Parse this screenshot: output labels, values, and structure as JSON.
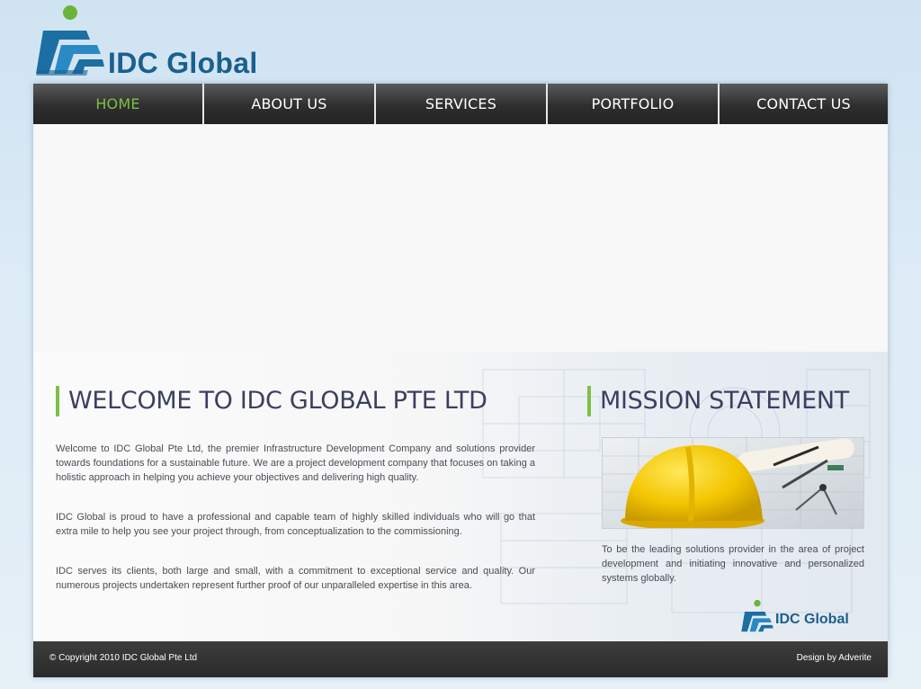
{
  "brand": {
    "name": "IDC Global",
    "primary_color": "#1b5f8f",
    "accent_color": "#7dc142",
    "logo_icon": "idc-logo-icon"
  },
  "nav": {
    "items": [
      {
        "label": "HOME",
        "active": true
      },
      {
        "label": "ABOUT US",
        "active": false
      },
      {
        "label": "SERVICES",
        "active": false
      },
      {
        "label": "PORTFOLIO",
        "active": false
      },
      {
        "label": "CONTACT US",
        "active": false
      }
    ]
  },
  "welcome": {
    "heading": "WELCOME TO IDC GLOBAL PTE LTD",
    "paragraphs": [
      "Welcome to IDC Global Pte Ltd, the premier Infrastructure Development Company and solutions provider towards foundations for a sustainable future. We are a project development company that focuses on taking a holistic approach in helping you achieve your objectives and delivering high quality.",
      "IDC Global is proud to have a professional and capable team of highly skilled individuals who will go  that extra mile to help you see your project through, from conceptualization to the commissioning.",
      "IDC serves its clients, both large and small, with a commitment to exceptional service and quality. Our numerous projects undertaken represent further proof of our unparalleled expertise in this area."
    ]
  },
  "mission": {
    "heading": "MISSION STATEMENT",
    "image_icon": "hard-hat-image",
    "text": "To be the leading solutions provider in the area of project development and initiating innovative and personalized systems globally."
  },
  "footer": {
    "copyright": "© Copyright 2010 IDC Global Pte Ltd",
    "credit": "Design by Adverite"
  }
}
